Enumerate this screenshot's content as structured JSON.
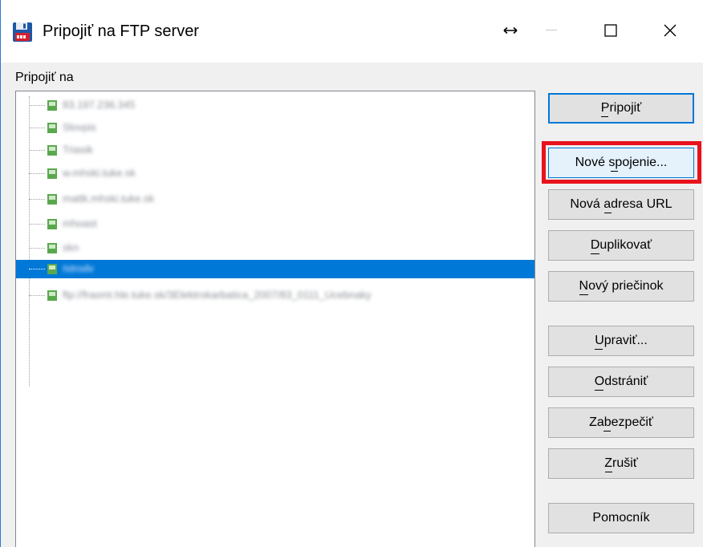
{
  "window": {
    "title": "Pripojiť na FTP server",
    "resize_glyph": "↔",
    "minimize_glyph": "—",
    "maximize_glyph": "☐",
    "close_glyph": "✕",
    "icon": "floppy-disk-icon"
  },
  "connect_label": "Pripojiť na",
  "tree": {
    "items": [
      {
        "label": "83.197.236.345",
        "selected": false
      },
      {
        "label": "Slovpis",
        "selected": false
      },
      {
        "label": "Triasik",
        "selected": false
      },
      {
        "label": "w.mhski.tuke.sk",
        "selected": false
      },
      {
        "label": "mattk.mhski.tuke.sk",
        "selected": false
      },
      {
        "label": "mhoast",
        "selected": false
      },
      {
        "label": "skn",
        "selected": false
      },
      {
        "label": "Istrodv",
        "selected": false
      },
      {
        "label": "ftp://frasmt.hle.tuke.sk/3Elektrokarbatica_2007/83_0111_Ucebnaky",
        "selected": false
      }
    ],
    "selected_index": 7
  },
  "buttons": {
    "connect": "Pripojiť",
    "new_connection": "Nové spojenie...",
    "new_url": "Nová adresa URL",
    "duplicate": "Duplikovať",
    "new_folder": "Nový priečinok",
    "edit": "Upraviť...",
    "remove": "Odstrániť",
    "secure": "Zabezpečiť",
    "cancel": "Zrušiť",
    "help": "Pomocník"
  },
  "colors": {
    "selection": "#0078d7",
    "highlight_box": "#e8121c",
    "window_border": "#2b79d5"
  }
}
